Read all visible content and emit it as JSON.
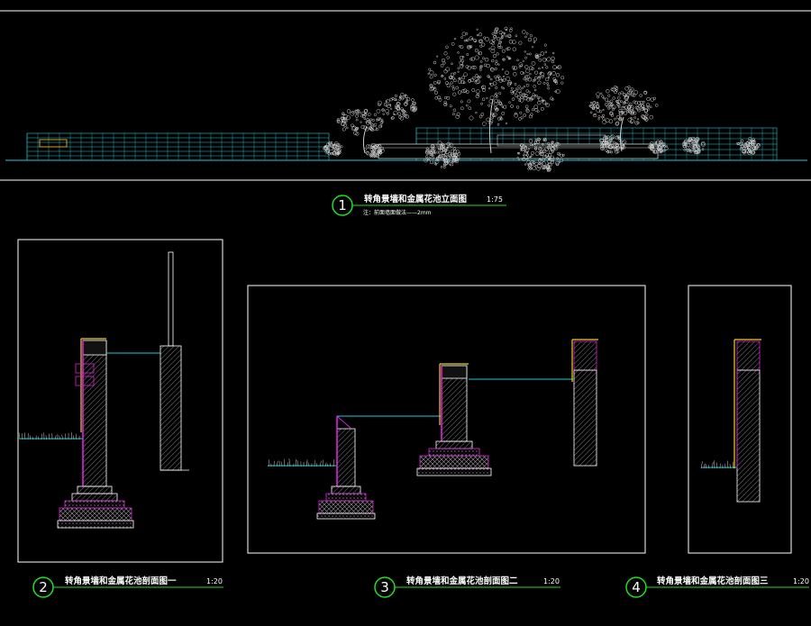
{
  "drawing": {
    "background": "#000000",
    "colors": {
      "line": "#ffffff",
      "cyan": "#22c8d8",
      "magenta": "#e020e0",
      "yellow": "#f0d020",
      "green": "#20e020",
      "gray": "#9a9a9a"
    },
    "title1": {
      "number": "1",
      "text": "转角景墙和金属花池立面图",
      "scale": "1:75",
      "note": "注：前面墙面做法——2mm"
    },
    "title2": {
      "number": "2",
      "text": "转角景墙和金属花池剖面图一",
      "scale": "1:20"
    },
    "title3": {
      "number": "3",
      "text": "转角景墙和金属花池剖面图二",
      "scale": "1:20"
    },
    "title4": {
      "number": "4",
      "text": "转角景墙和金属花池剖面图三",
      "scale": "1:20"
    }
  }
}
